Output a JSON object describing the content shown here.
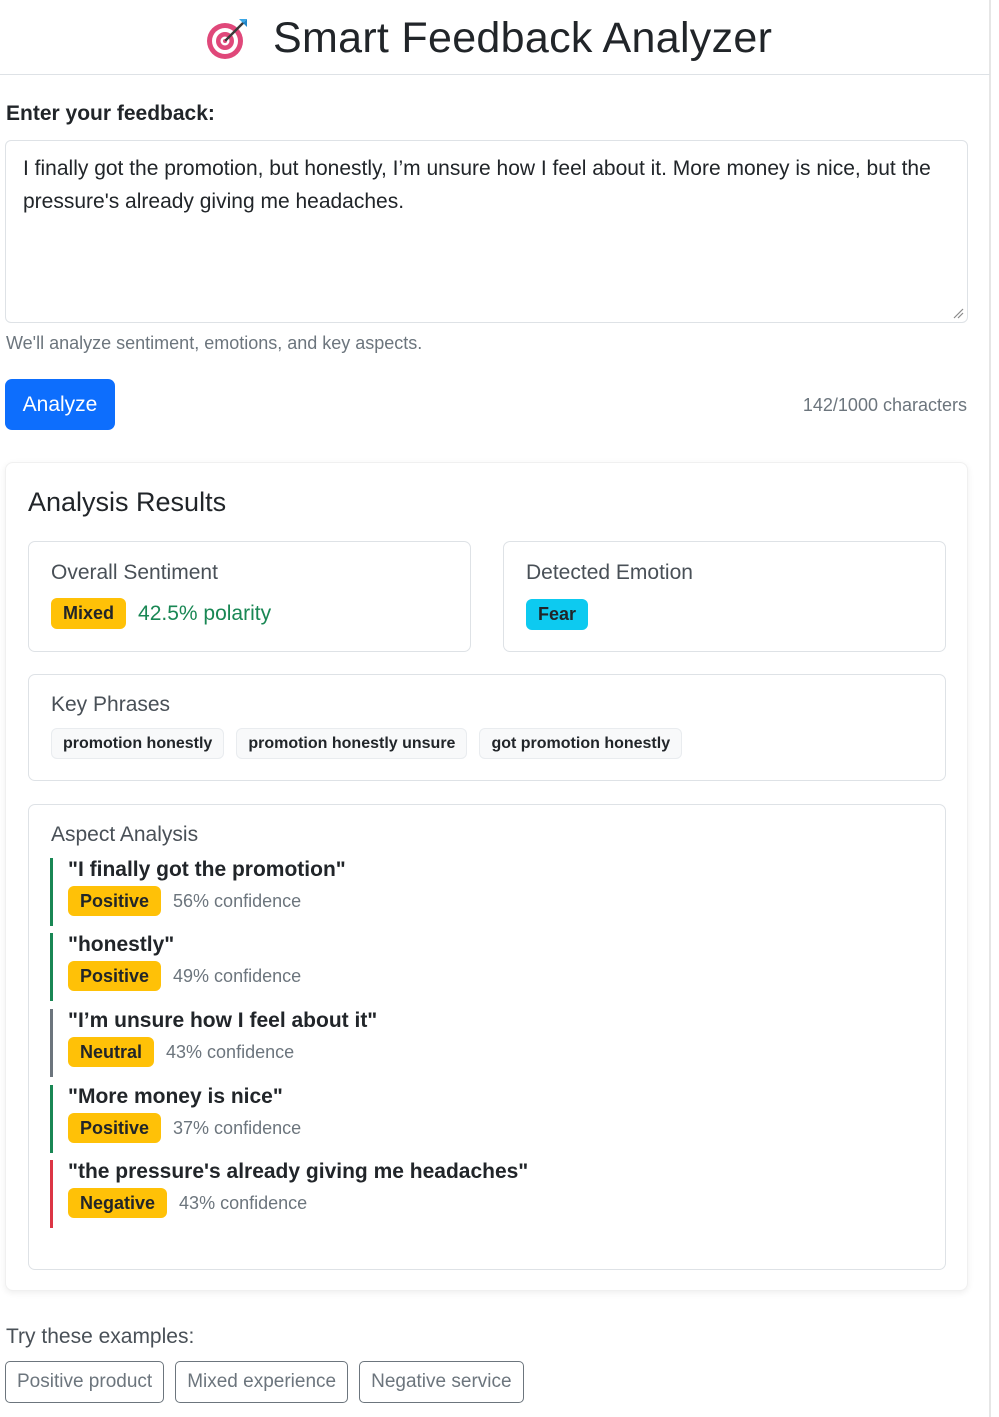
{
  "header": {
    "title": "Smart Feedback Analyzer",
    "logo_icon": "dart-target-icon"
  },
  "form": {
    "label": "Enter your feedback:",
    "feedback_value": "I finally got the promotion, but honestly, I’m unsure how I feel about it. More money is nice, but the pressure's already giving me headaches.",
    "help_text": "We'll analyze sentiment, emotions, and key aspects.",
    "analyze_label": "Analyze",
    "char_count": "142/1000 characters"
  },
  "results": {
    "title": "Analysis Results",
    "sentiment": {
      "heading": "Overall Sentiment",
      "label": "Mixed",
      "polarity": "42.5% polarity"
    },
    "emotion": {
      "heading": "Detected Emotion",
      "label": "Fear"
    },
    "key_phrases": {
      "heading": "Key Phrases",
      "items": [
        "promotion honestly",
        "promotion honestly unsure",
        "got promotion honestly"
      ]
    },
    "aspects": {
      "heading": "Aspect Analysis",
      "items": [
        {
          "quote": "\"I finally got the promotion\"",
          "sentiment": "Positive",
          "confidence": "56% confidence"
        },
        {
          "quote": "\"honestly\"",
          "sentiment": "Positive",
          "confidence": "49% confidence"
        },
        {
          "quote": "\"I’m unsure how I feel about it\"",
          "sentiment": "Neutral",
          "confidence": "43% confidence"
        },
        {
          "quote": "\"More money is nice\"",
          "sentiment": "Positive",
          "confidence": "37% confidence"
        },
        {
          "quote": "\"the pressure's already giving me headaches\"",
          "sentiment": "Negative",
          "confidence": "43% confidence"
        }
      ]
    }
  },
  "examples": {
    "label": "Try these examples:",
    "buttons": [
      "Positive product",
      "Mixed experience",
      "Negative service"
    ]
  },
  "colors": {
    "primary": "#0d6efd",
    "warning": "#ffc107",
    "info": "#0dcaf0",
    "success": "#198754",
    "danger": "#dc3545",
    "secondary": "#6c757d"
  }
}
